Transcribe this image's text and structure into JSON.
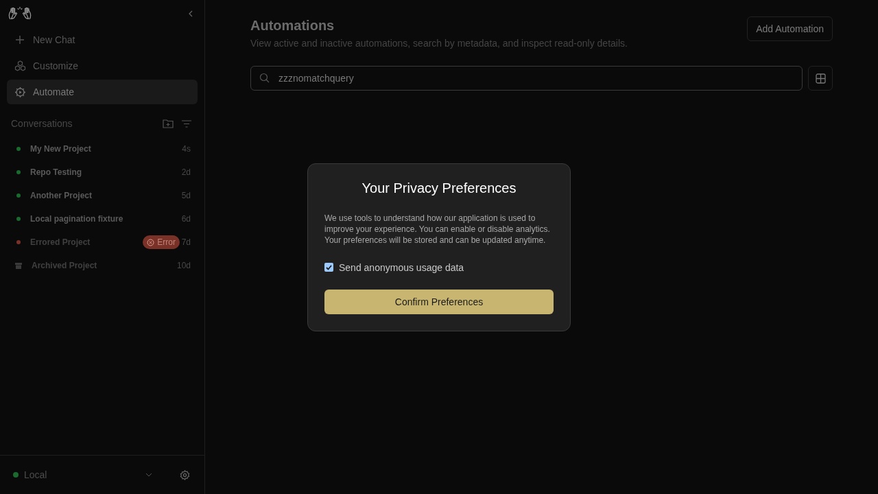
{
  "sidebar": {
    "nav": [
      {
        "label": "New Chat",
        "selected": false
      },
      {
        "label": "Customize",
        "selected": false
      },
      {
        "label": "Automate",
        "selected": true
      }
    ],
    "section_title": "Conversations",
    "conversations": [
      {
        "title": "My New Project",
        "age": "4s",
        "kind": "active",
        "color": "#1b6b30"
      },
      {
        "title": "Repo Testing",
        "age": "2d",
        "kind": "active",
        "color": "#1b6b30"
      },
      {
        "title": "Another Project",
        "age": "5d",
        "kind": "active",
        "color": "#1b6b30"
      },
      {
        "title": "Local pagination fixture",
        "age": "6d",
        "kind": "active",
        "color": "#1b6b30"
      },
      {
        "title": "Errored Project",
        "age": "7d",
        "kind": "error",
        "color": "#7a3228",
        "badge": "Error"
      },
      {
        "title": "Archived Project",
        "age": "10d",
        "kind": "archived"
      }
    ],
    "footer": {
      "label": "Local",
      "color": "#1b6b30"
    }
  },
  "page": {
    "title": "Automations",
    "subtitle": "View active and inactive automations, search by metadata, and inspect read-only details.",
    "add_button": "Add Automation",
    "search": {
      "value": "zzznomatchquery"
    }
  },
  "dialog": {
    "title": "Your Privacy Preferences",
    "body": "We use tools to understand how our application is used to improve your experience. You can enable or disable analytics. Your preferences will be stored and can be updated anytime.",
    "checkbox": {
      "label": "Send anonymous usage data",
      "checked": true
    },
    "button": "Confirm Preferences"
  }
}
